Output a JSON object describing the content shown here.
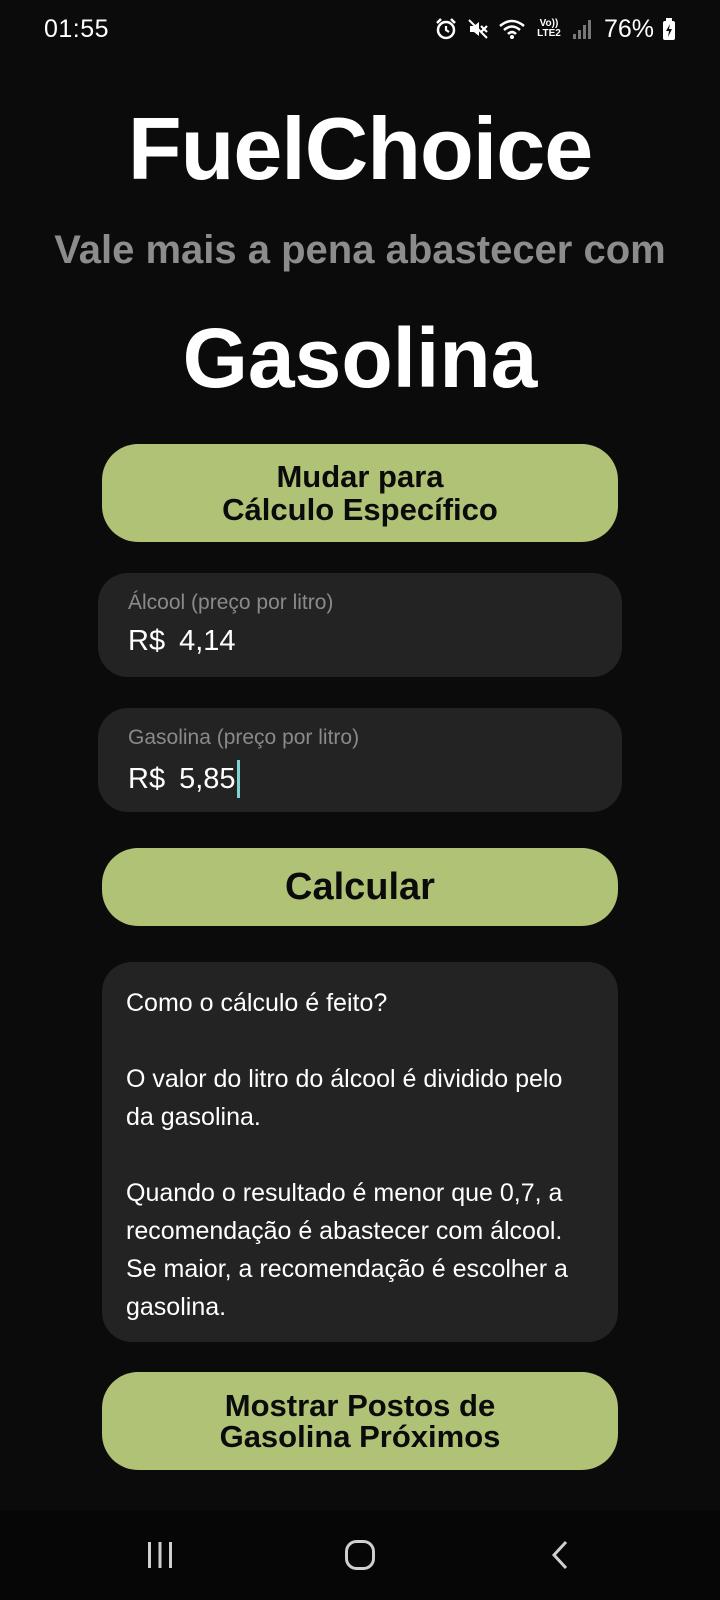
{
  "status_bar": {
    "time": "01:55",
    "battery_percent": "76%",
    "network_label": "Vo)) LTE2",
    "icons": [
      "alarm-icon",
      "mute-icon",
      "wifi-icon",
      "volte-icon",
      "signal-icon",
      "battery-charging-icon"
    ]
  },
  "app": {
    "title": "FuelChoice",
    "subtitle": "Vale mais a pena abastecer com",
    "result": "Gasolina"
  },
  "buttons": {
    "mode_line1": "Mudar para",
    "mode_line2": "Cálculo Específico",
    "calculate": "Calcular",
    "postos_line1": "Mostrar Postos de",
    "postos_line2": "Gasolina Próximos"
  },
  "fields": {
    "alcool": {
      "label": "Álcool (preço por litro)",
      "prefix": "R$",
      "value": "4,14"
    },
    "gasolina": {
      "label": "Gasolina (preço por litro)",
      "prefix": "R$",
      "value": "5,85"
    }
  },
  "info": {
    "question": "Como o cálculo é feito?",
    "paragraph1": "O valor do litro do álcool é dividido pelo da gasolina.",
    "paragraph2": "Quando o resultado é menor que 0,7, a recomendação é abastecer com álcool. Se maior, a recomendação é escolher a gasolina."
  },
  "nav": {
    "icons": [
      "recent-apps-icon",
      "home-icon",
      "back-icon"
    ]
  },
  "colors": {
    "accent": "#afc275",
    "background": "#0b0b0b",
    "card": "#232323",
    "cursor": "#7fd3d3"
  }
}
